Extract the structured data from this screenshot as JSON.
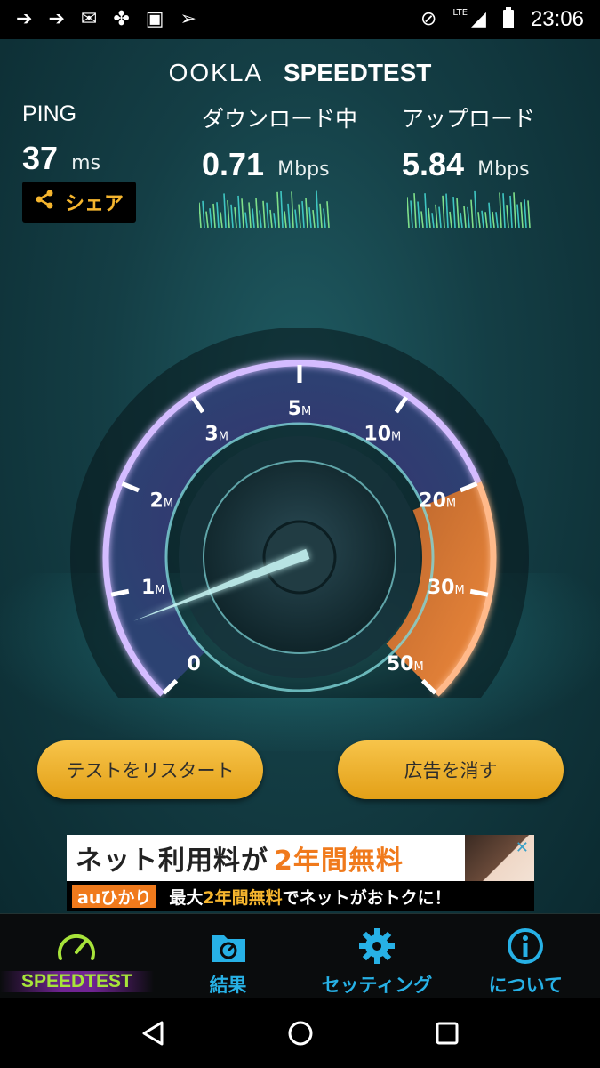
{
  "status_bar": {
    "time": "23:06",
    "network": "LTE",
    "left_icons": [
      "arrow-right-icon",
      "arrow-right-icon",
      "mail-icon",
      "fan-icon",
      "gmail-icon",
      "send-icon"
    ],
    "right_icons": [
      "do-not-disturb-icon",
      "signal-icon",
      "battery-icon"
    ]
  },
  "header": {
    "brand": "OOKLA",
    "product": "SPEEDTEST"
  },
  "metrics": {
    "ping": {
      "label": "PING",
      "value": "37",
      "unit": "ms"
    },
    "download": {
      "label": "ダウンロード中",
      "value": "0.71",
      "unit": "Mbps"
    },
    "upload": {
      "label": "アップロード",
      "value": "5.84",
      "unit": "Mbps"
    }
  },
  "share_button": {
    "label": "シェア",
    "icon": "share-icon"
  },
  "gauge": {
    "needle_value_mbps": 0.71,
    "tick_labels": [
      {
        "num": "0",
        "unit": ""
      },
      {
        "num": "1",
        "unit": "M"
      },
      {
        "num": "2",
        "unit": "M"
      },
      {
        "num": "3",
        "unit": "M"
      },
      {
        "num": "5",
        "unit": "M"
      },
      {
        "num": "10",
        "unit": "M"
      },
      {
        "num": "20",
        "unit": "M"
      },
      {
        "num": "30",
        "unit": "M"
      },
      {
        "num": "50",
        "unit": "M"
      }
    ],
    "colors": {
      "arc": "#c9a6ff",
      "high_zone": "#f08a3c",
      "needle": "#bff3f3"
    }
  },
  "actions": {
    "restart_label": "テストをリスタート",
    "remove_ads_label": "広告を消す"
  },
  "ad": {
    "headline_prefix": "ネット利用料が",
    "headline_highlight": "2年間無料",
    "logo_text": "auひかり",
    "sub_prefix": "最大",
    "sub_highlight": "2年間無料",
    "sub_suffix": "でネットがおトクに！",
    "close": "✕"
  },
  "bottom_nav": {
    "items": [
      {
        "label": "SPEEDTEST",
        "icon": "speedometer-icon",
        "active": true
      },
      {
        "label": "結果",
        "icon": "results-folder-icon",
        "active": false
      },
      {
        "label": "セッティング",
        "icon": "gear-icon",
        "active": false
      },
      {
        "label": "について",
        "icon": "info-icon",
        "active": false
      }
    ]
  },
  "system_nav": {
    "icons": [
      "back-icon",
      "home-icon",
      "recents-icon"
    ]
  },
  "colors": {
    "accent": "#27b1e6",
    "active": "#a7e43a",
    "button": "#f5b52e"
  }
}
